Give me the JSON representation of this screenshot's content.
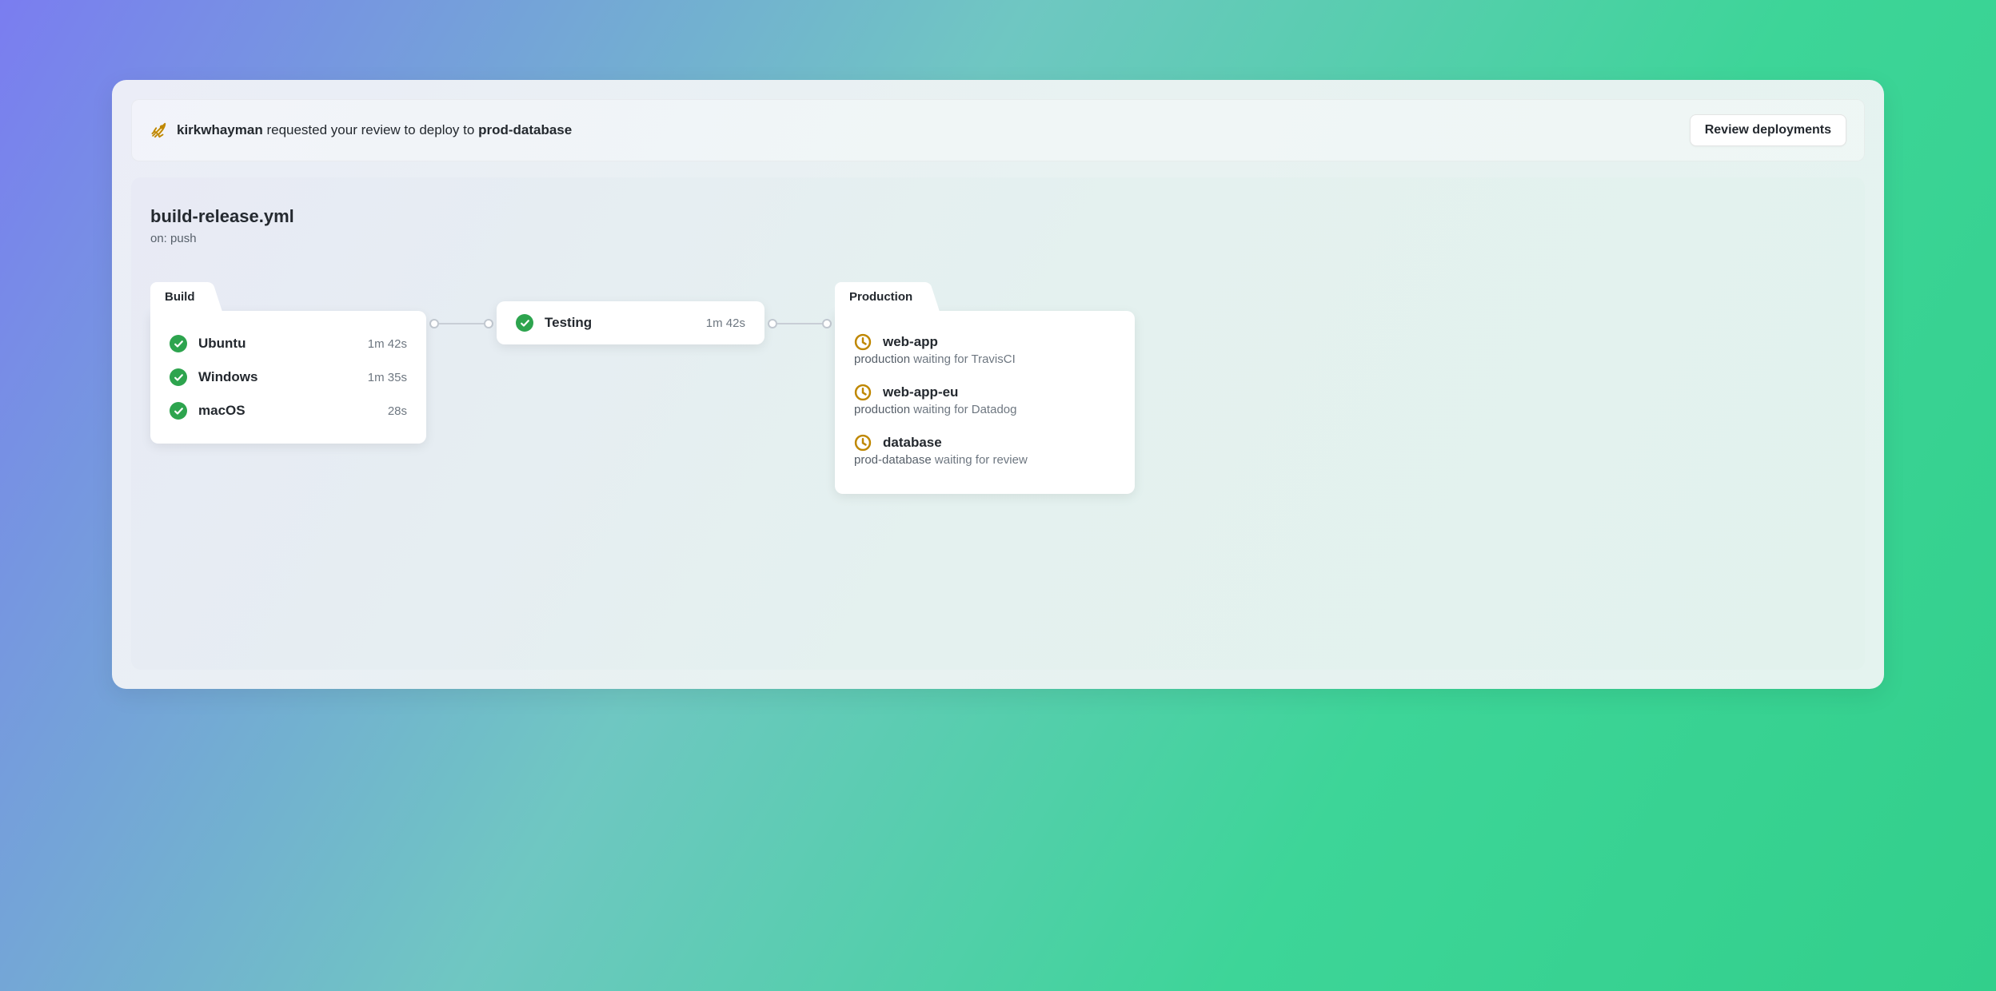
{
  "banner": {
    "actor": "kirkwhayman",
    "middle": " requested your review to deploy to ",
    "target": "prod-database",
    "review_button": "Review deployments"
  },
  "workflow": {
    "title": "build-release.yml",
    "trigger": "on: push"
  },
  "stages": {
    "build": {
      "label": "Build",
      "jobs": [
        {
          "name": "Ubuntu",
          "time": "1m 42s"
        },
        {
          "name": "Windows",
          "time": "1m 35s"
        },
        {
          "name": "macOS",
          "time": "28s"
        }
      ]
    },
    "testing": {
      "name": "Testing",
      "time": "1m 42s"
    },
    "production": {
      "label": "Production",
      "jobs": [
        {
          "name": "web-app",
          "env": "production",
          "status_text": " waiting for TravisCI"
        },
        {
          "name": "web-app-eu",
          "env": "production",
          "status_text": " waiting for Datadog"
        },
        {
          "name": "database",
          "env": "prod-database",
          "status_text": " waiting for review"
        }
      ]
    }
  },
  "colors": {
    "success": "#2da44e",
    "pending": "#bf8700"
  }
}
